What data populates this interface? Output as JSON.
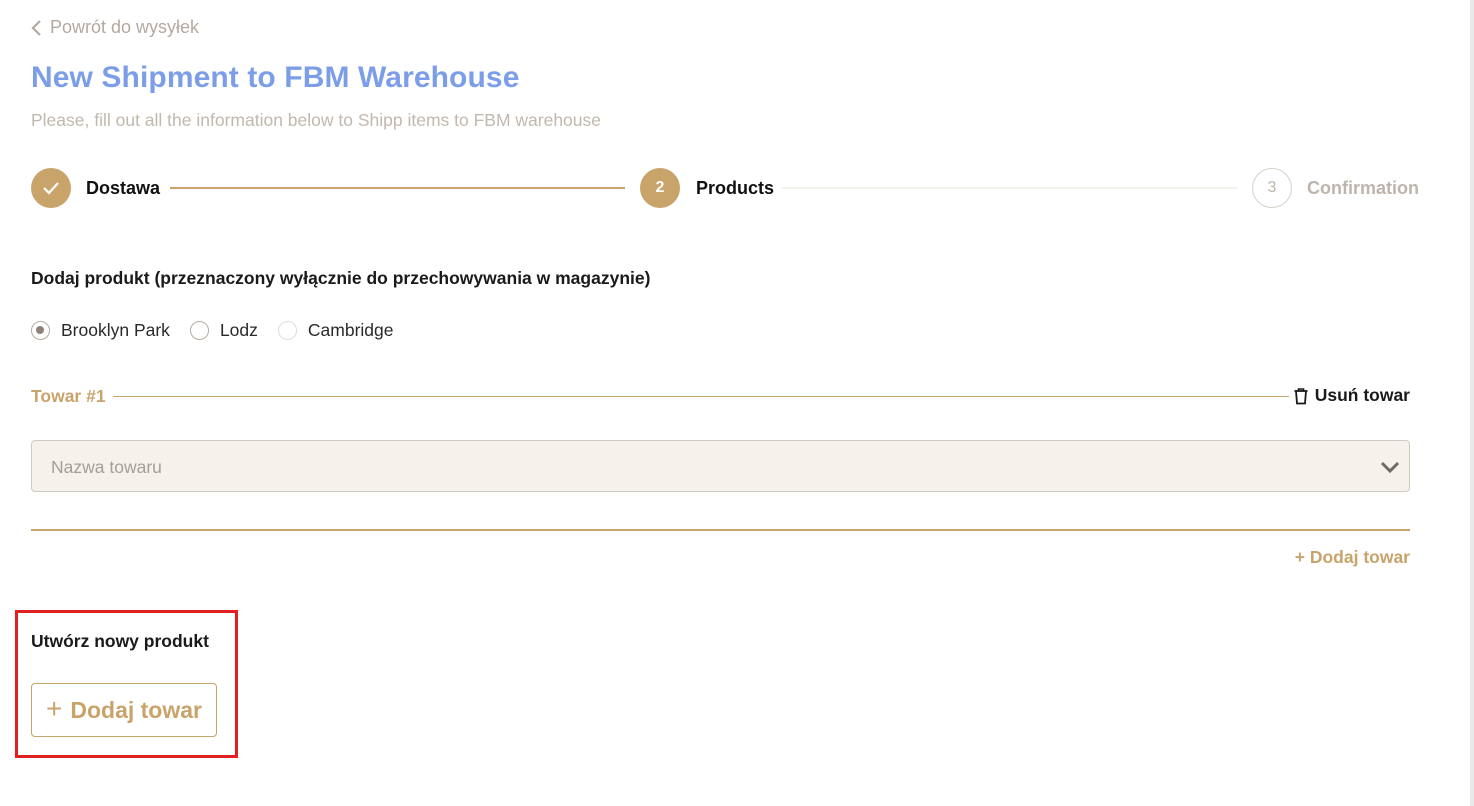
{
  "back_link": {
    "label": "Powrót do wysyłek"
  },
  "header": {
    "title": "New Shipment to FBM Warehouse",
    "subtitle": "Please, fill out all the information below to Shipp items to FBM warehouse"
  },
  "stepper": {
    "steps": [
      {
        "number": "1",
        "label": "Dostawa",
        "state": "done"
      },
      {
        "number": "2",
        "label": "Products",
        "state": "active"
      },
      {
        "number": "3",
        "label": "Confirmation",
        "state": "pending"
      }
    ]
  },
  "add_product": {
    "label": "Dodaj produkt (przeznaczony wyłącznie do przechowywania w magazynie)",
    "warehouses": [
      {
        "label": "Brooklyn Park",
        "selected": true
      },
      {
        "label": "Lodz",
        "selected": false
      },
      {
        "label": "Cambridge",
        "selected": false
      }
    ]
  },
  "item": {
    "title": "Towar #1",
    "remove_label": "Usuń towar",
    "select_placeholder": "Nazwa towaru"
  },
  "add_item_link": "+ Dodaj towar",
  "create_product": {
    "label": "Utwórz nowy produkt",
    "button_label": "Dodaj towar"
  },
  "colors": {
    "accent_gold": "#c8a36a",
    "title_blue": "#7c9ee8",
    "highlight_red": "#e02020"
  }
}
